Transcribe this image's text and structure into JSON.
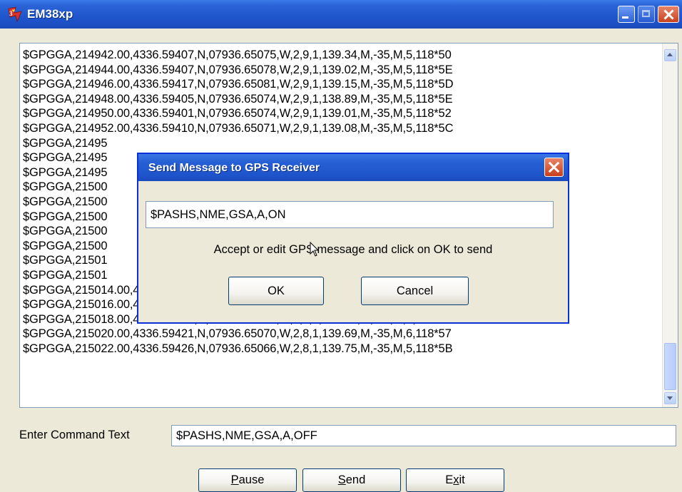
{
  "window": {
    "title": "EM38xp",
    "colors": {
      "titlebar": "#1f55cc",
      "face": "#ece9d8",
      "close": "#c8421f"
    }
  },
  "log": {
    "lines": [
      "$GPGGA,214942.00,4336.59407,N,07936.65075,W,2,9,1,139.34,M,-35,M,5,118*50",
      "$GPGGA,214944.00,4336.59407,N,07936.65078,W,2,9,1,139.02,M,-35,M,5,118*5E",
      "$GPGGA,214946.00,4336.59417,N,07936.65081,W,2,9,1,139.15,M,-35,M,5,118*5D",
      "$GPGGA,214948.00,4336.59405,N,07936.65074,W,2,9,1,138.89,M,-35,M,5,118*5E",
      "$GPGGA,214950.00,4336.59401,N,07936.65074,W,2,9,1,139.01,M,-35,M,5,118*52",
      "$GPGGA,214952.00,4336.59410,N,07936.65071,W,2,9,1,139.08,M,-35,M,5,118*5C",
      "$GPGGA,21495",
      "$GPGGA,21495",
      "$GPGGA,21495",
      "$GPGGA,21500",
      "$GPGGA,21500",
      "$GPGGA,21500",
      "$GPGGA,21500",
      "$GPGGA,21500",
      "$GPGGA,21501",
      "$GPGGA,21501",
      "$GPGGA,215014.00,4336.59399,N,07936.65071,W,2,9,1,139.31,M,-35,M,6,118*59",
      "$GPGGA,215016.00,4336.59407,N,07936.65070,W,2,9,1,139.51,M,-35,M,6,118*5C",
      "$GPGGA,215018.00,4336.59424,N,07936.65075,W,2,9,1,139.71,M,-35,M,6,118*54",
      "$GPGGA,215020.00,4336.59421,N,07936.65070,W,2,8,1,139.69,M,-35,M,6,118*57",
      "$GPGGA,215022.00,4336.59426,N,07936.65066,W,2,8,1,139.75,M,-35,M,5,118*5B"
    ]
  },
  "command": {
    "label": "Enter Command Text",
    "value": "$PASHS,NME,GSA,A,OFF"
  },
  "buttons": {
    "pause": {
      "pre": "",
      "accel": "P",
      "post": "ause"
    },
    "send": {
      "pre": "",
      "accel": "S",
      "post": "end"
    },
    "exit": {
      "pre": "E",
      "accel": "x",
      "post": "it"
    }
  },
  "dialog": {
    "title": "Send Message to GPS Receiver",
    "message_value": "$PASHS,NME,GSA,A,ON",
    "instruction": "Accept or edit GPS message and click on OK to send",
    "ok_label": "OK",
    "cancel_label": "Cancel"
  },
  "icons": {
    "app": "em38-app-icon",
    "minimize": "minimize-icon",
    "maximize": "maximize-icon",
    "close": "close-icon",
    "scroll_up": "chevron-up-icon",
    "scroll_down": "chevron-down-icon",
    "cursor": "mouse-pointer-icon"
  }
}
